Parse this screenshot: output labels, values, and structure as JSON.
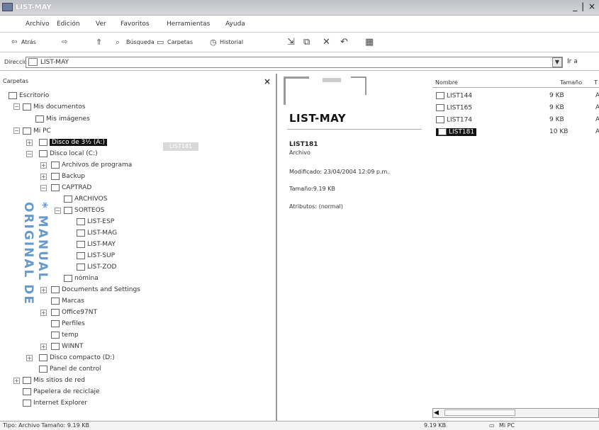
{
  "window": {
    "title": "LIST-MAY",
    "controls": "_ | ×"
  },
  "menu": [
    "Archivo",
    "Edición",
    "Ver",
    "Favoritos",
    "Herramientas",
    "Ayuda"
  ],
  "toolbar": {
    "back": "Atrás",
    "search": "Búsqueda",
    "folders": "Carpetas",
    "history": "Historial"
  },
  "address": {
    "label": "Dirección",
    "value": "LIST-MAY",
    "go": "Ir a"
  },
  "left_pane": {
    "header": "Carpetas",
    "close": "×",
    "drag_ghost": "LIST181",
    "tree": [
      {
        "label": "Escritorio"
      },
      {
        "label": "Mis documentos"
      },
      {
        "label": "Mis imágenes"
      },
      {
        "label": "Mi PC"
      },
      {
        "label": "Disco de 3½ (A:)"
      },
      {
        "label": "Disco local (C:)"
      },
      {
        "label": "Archivos de programa"
      },
      {
        "label": "Backup"
      },
      {
        "label": "CAPTRAD"
      },
      {
        "label": "ARCHIVOS"
      },
      {
        "label": "SORTEOS"
      },
      {
        "label": "LIST-ESP"
      },
      {
        "label": "LIST-MAG"
      },
      {
        "label": "LIST-MAY"
      },
      {
        "label": "LIST-SUP"
      },
      {
        "label": "LIST-ZOD"
      },
      {
        "label": "nómina"
      },
      {
        "label": "Documents and Settings"
      },
      {
        "label": "Marcas"
      },
      {
        "label": "Office97NT"
      },
      {
        "label": "Perfiles"
      },
      {
        "label": "temp"
      },
      {
        "label": "WINNT"
      },
      {
        "label": "Disco compacto (D:)"
      },
      {
        "label": "Panel de control"
      },
      {
        "label": "Mis sitios de red"
      },
      {
        "label": "Papelera de reciclaje"
      },
      {
        "label": "Internet Explorer"
      }
    ],
    "watermark": "* MANUAL ORIGINAL DE"
  },
  "preview": {
    "title": "LIST-MAY",
    "file_name": "LIST181",
    "file_type": "Archivo",
    "modified": "Modificado: 23/04/2004 12:09 p.m.",
    "size": "Tamaño:9.19 KB",
    "attributes": "Atributos: (normal)"
  },
  "file_list": {
    "headers": {
      "name": "Nombre",
      "size": "Tamaño",
      "type": "T"
    },
    "rows": [
      {
        "name": "LIST144",
        "size": "9 KB",
        "type": "A"
      },
      {
        "name": "LIST165",
        "size": "9 KB",
        "type": "A"
      },
      {
        "name": "LIST174",
        "size": "9 KB",
        "type": "A"
      },
      {
        "name": "LIST181",
        "size": "10 KB",
        "type": "A"
      }
    ]
  },
  "status": {
    "left": "Tipo: Archivo Tamaño: 9.19 KB",
    "size": "9.19 KB",
    "location": "Mi PC"
  }
}
